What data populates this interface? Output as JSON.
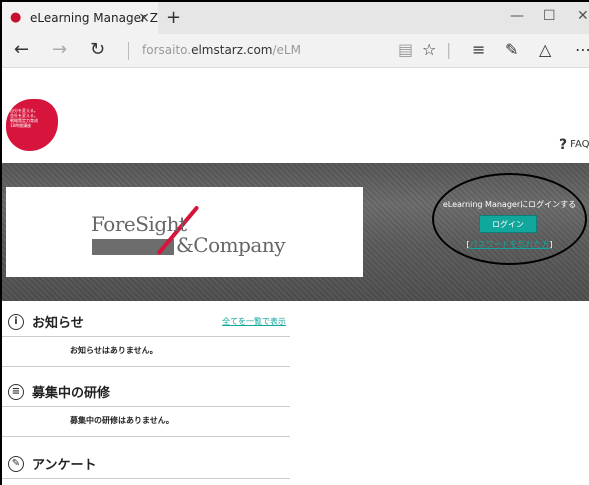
{
  "browser": {
    "tab_title": "eLearning Manager Z",
    "tab_close": "×",
    "new_tab": "+",
    "url_prefix": "forsaito.",
    "url_domain": "elmstarz.com",
    "url_path": "/eLM",
    "icons": [
      "back-icon",
      "forward-icon",
      "refresh-icon",
      "reading-view-icon",
      "favorite-star-icon",
      "hub-icon",
      "web-note-icon",
      "share-icon",
      "more-icon"
    ]
  },
  "header": {
    "logo_lines": [
      "自分を変える。",
      "会社を変える。",
      "戦略策定力育成",
      "18時間講座"
    ],
    "faq_label": "FAQ"
  },
  "hero": {
    "logo_text_1": "ForeSight",
    "logo_text_2": "&Company",
    "login_message": "eLearning Managerにログインする",
    "login_button": "ログイン",
    "password_link_prefix": "[",
    "password_link": "パスワードを忘れた方",
    "password_link_suffix": "]"
  },
  "sections": [
    {
      "title": "お知らせ",
      "link": "全てを一覧で表示",
      "body": "お知らせはありません。",
      "icon": "info-icon"
    },
    {
      "title": "募集中の研修",
      "link": "",
      "body": "募集中の研修はありません。",
      "icon": "list-icon"
    },
    {
      "title": "アンケート",
      "link": "",
      "body": "",
      "icon": "pencil-icon"
    }
  ],
  "colors": {
    "accent": "#12a79c",
    "brand": "#d6143c"
  }
}
